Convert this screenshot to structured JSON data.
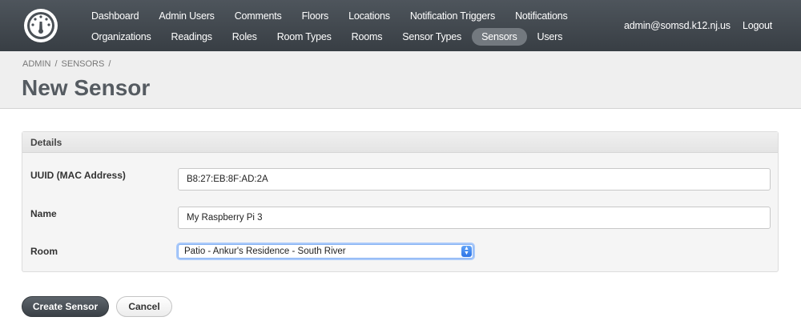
{
  "header": {
    "nav_row1": [
      "Dashboard",
      "Admin Users",
      "Comments",
      "Floors",
      "Locations",
      "Notification Triggers",
      "Notifications"
    ],
    "nav_row2": [
      "Organizations",
      "Readings",
      "Roles",
      "Room Types",
      "Rooms",
      "Sensor Types",
      "Sensors",
      "Users"
    ],
    "active_item": "Sensors",
    "user_email": "admin@somsd.k12.nj.us",
    "logout_label": "Logout"
  },
  "breadcrumb": [
    "ADMIN",
    "/",
    "SENSORS",
    "/"
  ],
  "page_title": "New Sensor",
  "form": {
    "panel_title": "Details",
    "uuid": {
      "label": "UUID (MAC Address)",
      "value": "B8:27:EB:8F:AD:2A"
    },
    "name": {
      "label": "Name",
      "value": "My Raspberry Pi 3"
    },
    "room": {
      "label": "Room",
      "selected": "Patio - Ankur's Residence - South River"
    }
  },
  "actions": {
    "submit_label": "Create Sensor",
    "cancel_label": "Cancel"
  },
  "colors": {
    "header_bg": "#444a50",
    "active_pill": "#73797f",
    "primary_button": "#4a5056",
    "select_focus": "#2c73e6"
  }
}
